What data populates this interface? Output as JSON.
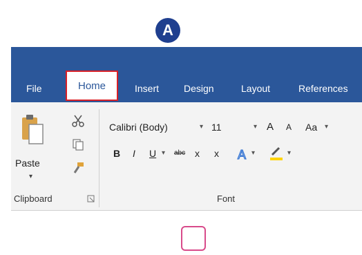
{
  "marker": {
    "label": "A"
  },
  "tabs": [
    {
      "label": "File"
    },
    {
      "label": "Home",
      "selected": true
    },
    {
      "label": "Insert"
    },
    {
      "label": "Design"
    },
    {
      "label": "Layout"
    },
    {
      "label": "References"
    }
  ],
  "clipboard": {
    "paste_label": "Paste",
    "group_label": "Clipboard"
  },
  "font": {
    "font_name": "Calibri (Body)",
    "font_size": "11",
    "grow_label": "A",
    "shrink_label": "A",
    "case_label": "Aa",
    "bold_label": "B",
    "italic_label": "I",
    "underline_label": "U",
    "strike_label": "abc",
    "subscript_label": "x",
    "superscript_label": "x",
    "group_label": "Font"
  },
  "colors": {
    "ribbon_blue": "#2b579a",
    "highlight_red": "#d81f26",
    "marker_blue": "#1f3f8f",
    "placeholder_pink": "#d84a8a"
  }
}
